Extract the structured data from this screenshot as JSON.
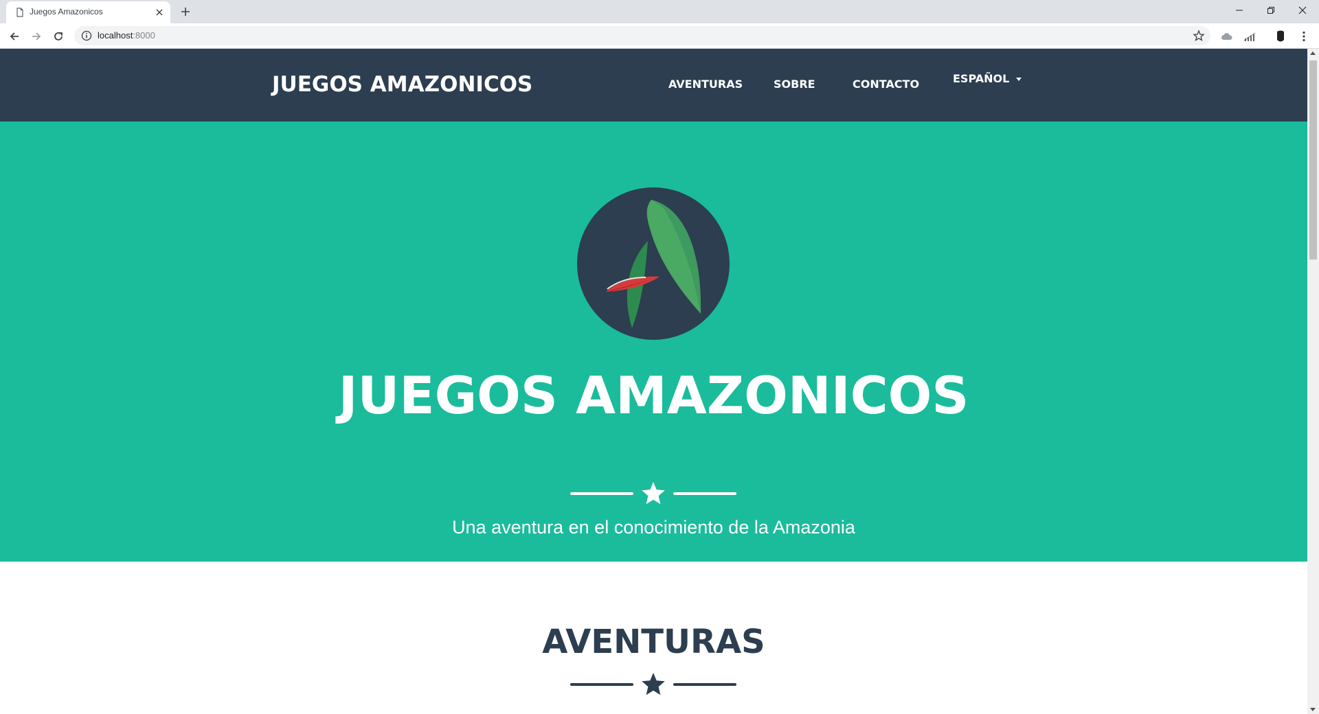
{
  "browser": {
    "tab_title": "Juegos Amazonicos",
    "url_host": "localhost",
    "url_port": ":8000"
  },
  "navbar": {
    "brand": "JUEGOS AMAZONICOS",
    "links": [
      "AVENTURAS",
      "SOBRE",
      "CONTACTO"
    ],
    "language_label": "ESPAÑOL"
  },
  "masthead": {
    "title": "JUEGOS AMAZONICOS",
    "subtitle": "Una aventura en el conocimiento de la Amazonia"
  },
  "section": {
    "heading": "AVENTURAS"
  },
  "colors": {
    "navbar_bg": "#2c3e50",
    "masthead_bg": "#1abc9c",
    "heading_text": "#2c3e50",
    "leaf_green": "#4aa963",
    "leaf_red": "#d63a3a"
  },
  "icons": [
    "page-icon",
    "close-icon",
    "plus-icon",
    "minimize-icon",
    "restore-icon",
    "back-arrow-icon",
    "forward-arrow-icon",
    "reload-icon",
    "info-icon",
    "star-icon",
    "leaf-logo-icon",
    "caret-down-icon"
  ]
}
